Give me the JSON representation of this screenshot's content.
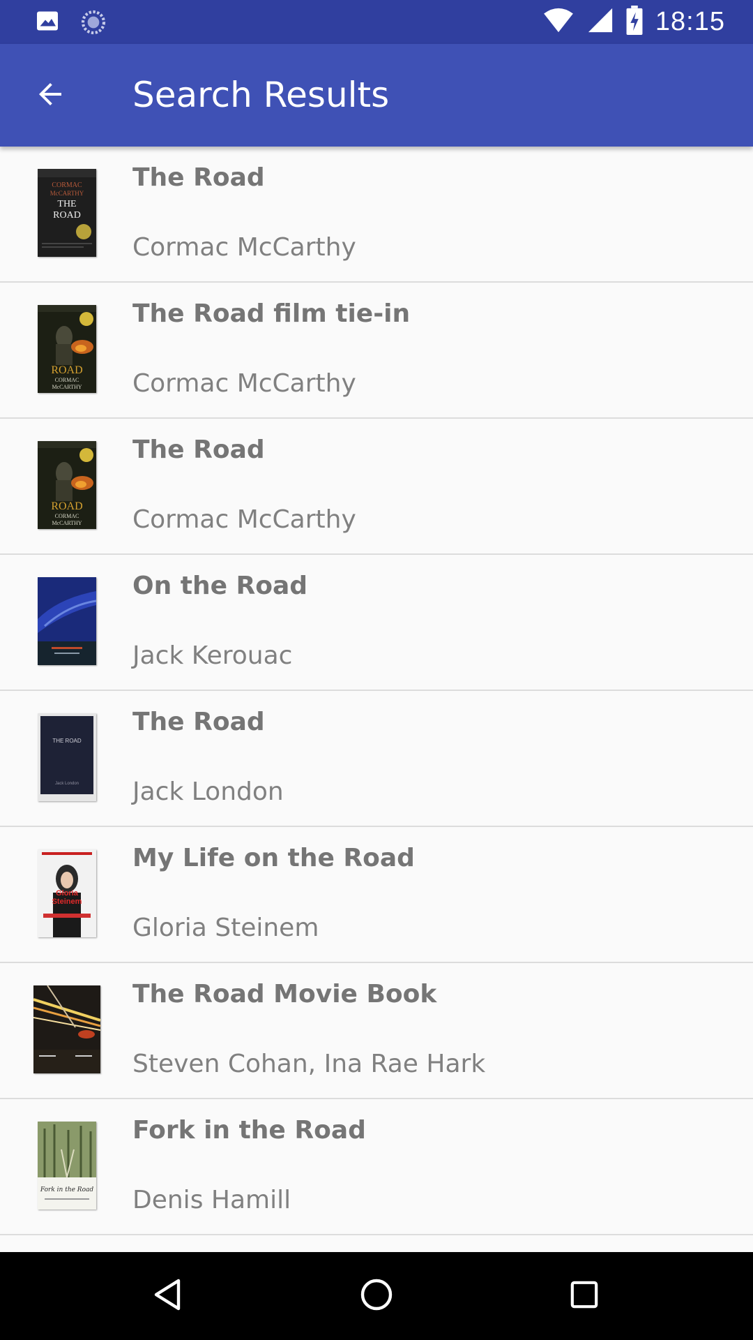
{
  "status_bar": {
    "time": "18:15",
    "icons": [
      "image-icon",
      "sync-icon",
      "wifi-icon",
      "signal-icon",
      "battery-charging-icon"
    ]
  },
  "app_bar": {
    "back_icon": "arrow-back-icon",
    "title": "Search Results"
  },
  "results": [
    {
      "title": "The Road",
      "author": "Cormac McCarthy",
      "cover": "road-mccarthy-black"
    },
    {
      "title": "The Road film tie-in",
      "author": "Cormac McCarthy",
      "cover": "road-film"
    },
    {
      "title": "The Road",
      "author": "Cormac McCarthy",
      "cover": "road-film"
    },
    {
      "title": "On the Road",
      "author": "Jack Kerouac",
      "cover": "on-the-road-blue"
    },
    {
      "title": "The Road",
      "author": "Jack London",
      "cover": "road-london-navy"
    },
    {
      "title": "My Life on the Road",
      "author": "Gloria Steinem",
      "cover": "steinem-portrait"
    },
    {
      "title": "The Road Movie Book",
      "author": "Steven Cohan, Ina Rae Hark",
      "cover": "road-movie-lights"
    },
    {
      "title": "Fork in the Road",
      "author": "Denis Hamill",
      "cover": "fork-forest"
    }
  ],
  "nav_bar": {
    "icons": [
      "back-triangle-icon",
      "home-circle-icon",
      "recents-square-icon"
    ]
  },
  "colors": {
    "status_bar": "#303f9f",
    "app_bar": "#3f51b5",
    "background": "#fafafa",
    "title_text": "#757575",
    "author_text": "#808080"
  }
}
